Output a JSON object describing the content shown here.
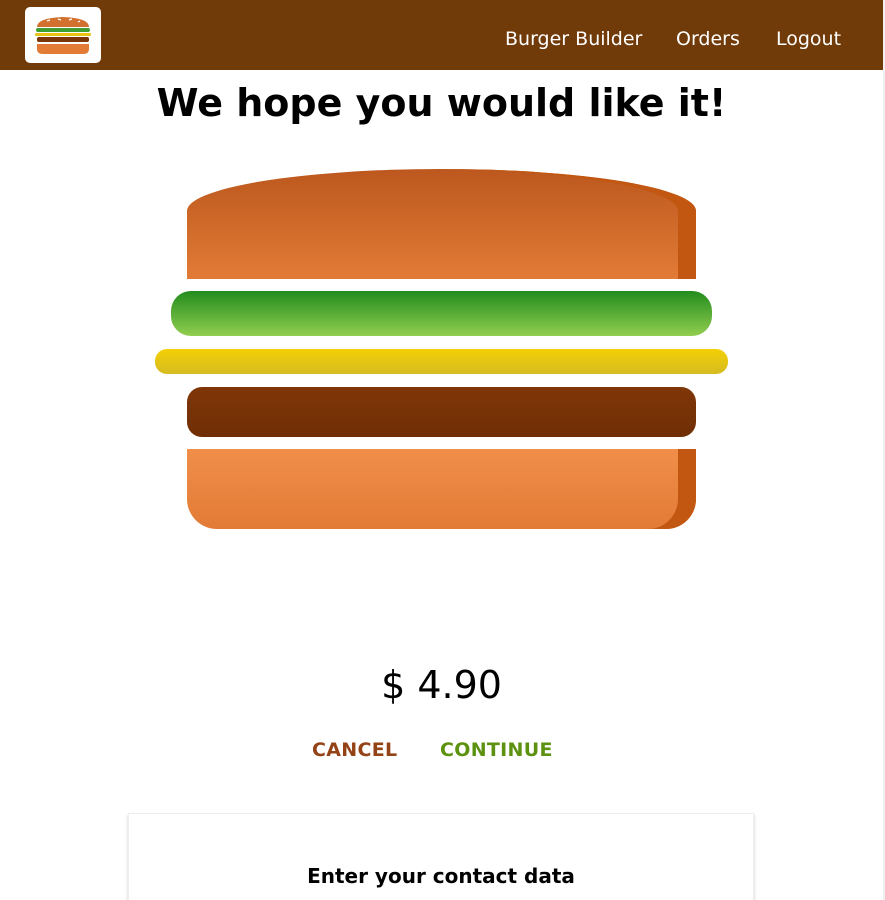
{
  "nav": {
    "logo_icon": "burger-logo-icon",
    "items": [
      {
        "label": "Burger Builder"
      },
      {
        "label": "Orders"
      },
      {
        "label": "Logout"
      }
    ]
  },
  "main": {
    "title": "We hope you would like it!",
    "burger_layers": [
      "bread-top",
      "salad",
      "cheese",
      "meat",
      "bread-bottom"
    ],
    "price": "$ 4.90",
    "cancel_label": "CANCEL",
    "continue_label": "CONTINUE"
  },
  "contact": {
    "title": "Enter your contact data"
  },
  "colors": {
    "toolbar": "#703b09",
    "cancel": "#944317",
    "continue": "#5c9210"
  }
}
